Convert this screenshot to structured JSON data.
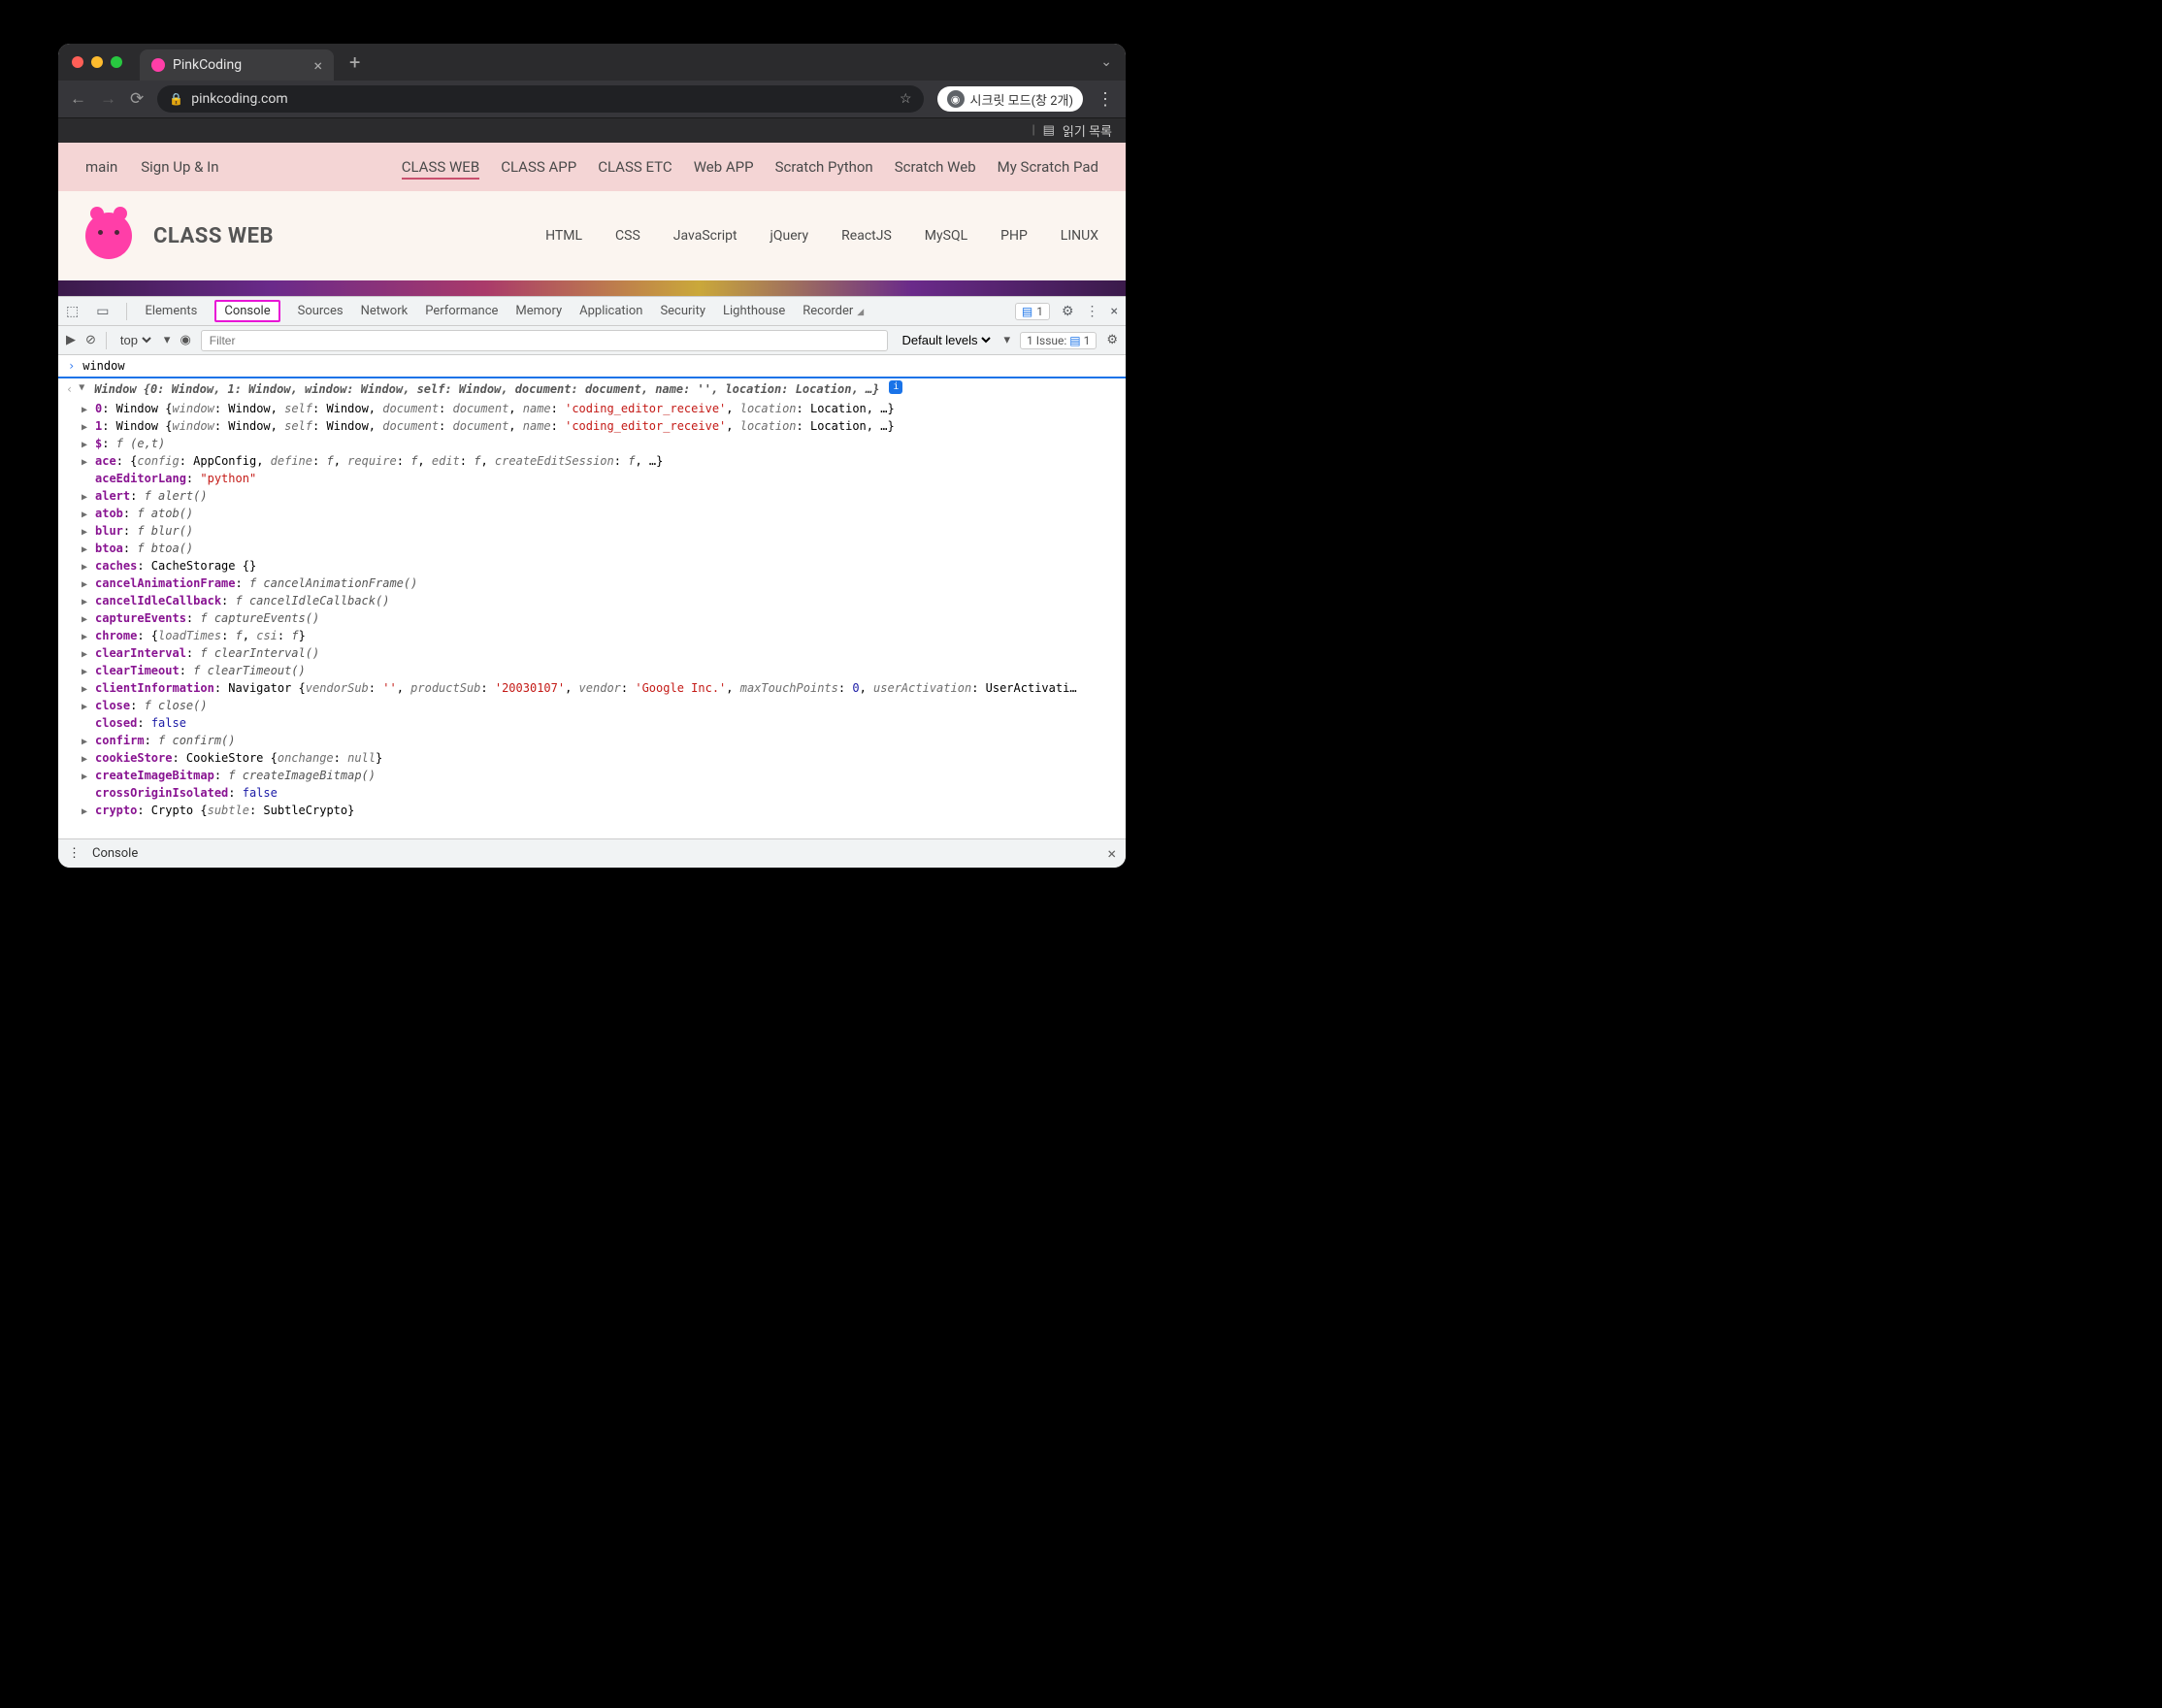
{
  "browser": {
    "tab_title": "PinkCoding",
    "url": "pinkcoding.com",
    "incognito_label": "시크릿 모드(창 2개)",
    "reading_list": "읽기 목록"
  },
  "site": {
    "topnav": {
      "main": "main",
      "signup": "Sign Up & In",
      "links": [
        "CLASS WEB",
        "CLASS APP",
        "CLASS ETC",
        "Web APP",
        "Scratch Python",
        "Scratch Web",
        "My Scratch Pad"
      ],
      "active_index": 0
    },
    "brand": "CLASS WEB",
    "subnav": [
      "HTML",
      "CSS",
      "JavaScript",
      "jQuery",
      "ReactJS",
      "MySQL",
      "PHP",
      "LINUX"
    ]
  },
  "devtools": {
    "tabs": [
      "Elements",
      "Console",
      "Sources",
      "Network",
      "Performance",
      "Memory",
      "Application",
      "Security",
      "Lighthouse",
      "Recorder"
    ],
    "highlighted_index": 1,
    "badge_count": "1",
    "toolbar": {
      "context": "top",
      "filter_placeholder": "Filter",
      "levels": "Default levels",
      "issue_text": "1 Issue:",
      "issue_count": "1"
    },
    "prompt": "window",
    "summary": "Window {0: Window, 1: Window, window: Window, self: Window, document: document, name: '', location: Location, …}",
    "rows": [
      {
        "tri": "▶",
        "parts": [
          {
            "t": "0",
            "c": "k-prop"
          },
          {
            "t": ": Window {",
            "c": ""
          },
          {
            "t": "window",
            "c": "k-gray"
          },
          {
            "t": ": Window, ",
            "c": ""
          },
          {
            "t": "self",
            "c": "k-gray"
          },
          {
            "t": ": Window, ",
            "c": ""
          },
          {
            "t": "document",
            "c": "k-gray"
          },
          {
            "t": ": ",
            "c": ""
          },
          {
            "t": "document",
            "c": "k-gray"
          },
          {
            "t": ", ",
            "c": ""
          },
          {
            "t": "name",
            "c": "k-gray"
          },
          {
            "t": ": ",
            "c": ""
          },
          {
            "t": "'coding_editor_receive'",
            "c": "k-red"
          },
          {
            "t": ", ",
            "c": ""
          },
          {
            "t": "location",
            "c": "k-gray"
          },
          {
            "t": ": Location, …}",
            "c": ""
          }
        ]
      },
      {
        "tri": "▶",
        "parts": [
          {
            "t": "1",
            "c": "k-prop"
          },
          {
            "t": ": Window {",
            "c": ""
          },
          {
            "t": "window",
            "c": "k-gray"
          },
          {
            "t": ": Window, ",
            "c": ""
          },
          {
            "t": "self",
            "c": "k-gray"
          },
          {
            "t": ": Window, ",
            "c": ""
          },
          {
            "t": "document",
            "c": "k-gray"
          },
          {
            "t": ": ",
            "c": ""
          },
          {
            "t": "document",
            "c": "k-gray"
          },
          {
            "t": ", ",
            "c": ""
          },
          {
            "t": "name",
            "c": "k-gray"
          },
          {
            "t": ": ",
            "c": ""
          },
          {
            "t": "'coding_editor_receive'",
            "c": "k-red"
          },
          {
            "t": ", ",
            "c": ""
          },
          {
            "t": "location",
            "c": "k-gray"
          },
          {
            "t": ": Location, …}",
            "c": ""
          }
        ]
      },
      {
        "tri": "▶",
        "parts": [
          {
            "t": "$",
            "c": "k-prop"
          },
          {
            "t": ": ",
            "c": ""
          },
          {
            "t": "f (e,t)",
            "c": "k-func"
          }
        ]
      },
      {
        "tri": "▶",
        "parts": [
          {
            "t": "ace",
            "c": "k-prop"
          },
          {
            "t": ": {",
            "c": ""
          },
          {
            "t": "config",
            "c": "k-gray"
          },
          {
            "t": ": AppConfig, ",
            "c": ""
          },
          {
            "t": "define",
            "c": "k-gray"
          },
          {
            "t": ": ",
            "c": ""
          },
          {
            "t": "f",
            "c": "k-func"
          },
          {
            "t": ", ",
            "c": ""
          },
          {
            "t": "require",
            "c": "k-gray"
          },
          {
            "t": ": ",
            "c": ""
          },
          {
            "t": "f",
            "c": "k-func"
          },
          {
            "t": ", ",
            "c": ""
          },
          {
            "t": "edit",
            "c": "k-gray"
          },
          {
            "t": ": ",
            "c": ""
          },
          {
            "t": "f",
            "c": "k-func"
          },
          {
            "t": ", ",
            "c": ""
          },
          {
            "t": "createEditSession",
            "c": "k-gray"
          },
          {
            "t": ": ",
            "c": ""
          },
          {
            "t": "f",
            "c": "k-func"
          },
          {
            "t": ", …}",
            "c": ""
          }
        ]
      },
      {
        "tri": "",
        "parts": [
          {
            "t": "aceEditorLang",
            "c": "k-prop"
          },
          {
            "t": ": ",
            "c": ""
          },
          {
            "t": "\"python\"",
            "c": "k-red"
          }
        ]
      },
      {
        "tri": "▶",
        "parts": [
          {
            "t": "alert",
            "c": "k-prop"
          },
          {
            "t": ": ",
            "c": ""
          },
          {
            "t": "f alert()",
            "c": "k-func"
          }
        ]
      },
      {
        "tri": "▶",
        "parts": [
          {
            "t": "atob",
            "c": "k-prop"
          },
          {
            "t": ": ",
            "c": ""
          },
          {
            "t": "f atob()",
            "c": "k-func"
          }
        ]
      },
      {
        "tri": "▶",
        "parts": [
          {
            "t": "blur",
            "c": "k-prop"
          },
          {
            "t": ": ",
            "c": ""
          },
          {
            "t": "f blur()",
            "c": "k-func"
          }
        ]
      },
      {
        "tri": "▶",
        "parts": [
          {
            "t": "btoa",
            "c": "k-prop"
          },
          {
            "t": ": ",
            "c": ""
          },
          {
            "t": "f btoa()",
            "c": "k-func"
          }
        ]
      },
      {
        "tri": "▶",
        "parts": [
          {
            "t": "caches",
            "c": "k-prop"
          },
          {
            "t": ": CacheStorage {}",
            "c": ""
          }
        ]
      },
      {
        "tri": "▶",
        "parts": [
          {
            "t": "cancelAnimationFrame",
            "c": "k-prop"
          },
          {
            "t": ": ",
            "c": ""
          },
          {
            "t": "f cancelAnimationFrame()",
            "c": "k-func"
          }
        ]
      },
      {
        "tri": "▶",
        "parts": [
          {
            "t": "cancelIdleCallback",
            "c": "k-prop"
          },
          {
            "t": ": ",
            "c": ""
          },
          {
            "t": "f cancelIdleCallback()",
            "c": "k-func"
          }
        ]
      },
      {
        "tri": "▶",
        "parts": [
          {
            "t": "captureEvents",
            "c": "k-prop"
          },
          {
            "t": ": ",
            "c": ""
          },
          {
            "t": "f captureEvents()",
            "c": "k-func"
          }
        ]
      },
      {
        "tri": "▶",
        "parts": [
          {
            "t": "chrome",
            "c": "k-prop"
          },
          {
            "t": ": {",
            "c": ""
          },
          {
            "t": "loadTimes",
            "c": "k-gray"
          },
          {
            "t": ": ",
            "c": ""
          },
          {
            "t": "f",
            "c": "k-func"
          },
          {
            "t": ", ",
            "c": ""
          },
          {
            "t": "csi",
            "c": "k-gray"
          },
          {
            "t": ": ",
            "c": ""
          },
          {
            "t": "f",
            "c": "k-func"
          },
          {
            "t": "}",
            "c": ""
          }
        ]
      },
      {
        "tri": "▶",
        "parts": [
          {
            "t": "clearInterval",
            "c": "k-prop"
          },
          {
            "t": ": ",
            "c": ""
          },
          {
            "t": "f clearInterval()",
            "c": "k-func"
          }
        ]
      },
      {
        "tri": "▶",
        "parts": [
          {
            "t": "clearTimeout",
            "c": "k-prop"
          },
          {
            "t": ": ",
            "c": ""
          },
          {
            "t": "f clearTimeout()",
            "c": "k-func"
          }
        ]
      },
      {
        "tri": "▶",
        "parts": [
          {
            "t": "clientInformation",
            "c": "k-prop"
          },
          {
            "t": ": Navigator {",
            "c": ""
          },
          {
            "t": "vendorSub",
            "c": "k-gray"
          },
          {
            "t": ": ",
            "c": ""
          },
          {
            "t": "''",
            "c": "k-red"
          },
          {
            "t": ", ",
            "c": ""
          },
          {
            "t": "productSub",
            "c": "k-gray"
          },
          {
            "t": ": ",
            "c": ""
          },
          {
            "t": "'20030107'",
            "c": "k-red"
          },
          {
            "t": ", ",
            "c": ""
          },
          {
            "t": "vendor",
            "c": "k-gray"
          },
          {
            "t": ": ",
            "c": ""
          },
          {
            "t": "'Google Inc.'",
            "c": "k-red"
          },
          {
            "t": ", ",
            "c": ""
          },
          {
            "t": "maxTouchPoints",
            "c": "k-gray"
          },
          {
            "t": ": ",
            "c": ""
          },
          {
            "t": "0",
            "c": "k-blue"
          },
          {
            "t": ", ",
            "c": ""
          },
          {
            "t": "userActivation",
            "c": "k-gray"
          },
          {
            "t": ": UserActivati…",
            "c": ""
          }
        ]
      },
      {
        "tri": "▶",
        "parts": [
          {
            "t": "close",
            "c": "k-prop"
          },
          {
            "t": ": ",
            "c": ""
          },
          {
            "t": "f close()",
            "c": "k-func"
          }
        ]
      },
      {
        "tri": "",
        "parts": [
          {
            "t": "closed",
            "c": "k-prop"
          },
          {
            "t": ": ",
            "c": ""
          },
          {
            "t": "false",
            "c": "k-blue"
          }
        ]
      },
      {
        "tri": "▶",
        "parts": [
          {
            "t": "confirm",
            "c": "k-prop"
          },
          {
            "t": ": ",
            "c": ""
          },
          {
            "t": "f confirm()",
            "c": "k-func"
          }
        ]
      },
      {
        "tri": "▶",
        "parts": [
          {
            "t": "cookieStore",
            "c": "k-prop"
          },
          {
            "t": ": CookieStore {",
            "c": ""
          },
          {
            "t": "onchange",
            "c": "k-gray"
          },
          {
            "t": ": ",
            "c": ""
          },
          {
            "t": "null",
            "c": "k-gray"
          },
          {
            "t": "}",
            "c": ""
          }
        ]
      },
      {
        "tri": "▶",
        "parts": [
          {
            "t": "createImageBitmap",
            "c": "k-prop"
          },
          {
            "t": ": ",
            "c": ""
          },
          {
            "t": "f createImageBitmap()",
            "c": "k-func"
          }
        ]
      },
      {
        "tri": "",
        "parts": [
          {
            "t": "crossOriginIsolated",
            "c": "k-prop"
          },
          {
            "t": ": ",
            "c": ""
          },
          {
            "t": "false",
            "c": "k-blue"
          }
        ]
      },
      {
        "tri": "▶",
        "parts": [
          {
            "t": "crypto",
            "c": "k-prop"
          },
          {
            "t": ": Crypto {",
            "c": ""
          },
          {
            "t": "subtle",
            "c": "k-gray"
          },
          {
            "t": ": SubtleCrypto}",
            "c": ""
          }
        ]
      }
    ],
    "drawer_label": "Console"
  }
}
